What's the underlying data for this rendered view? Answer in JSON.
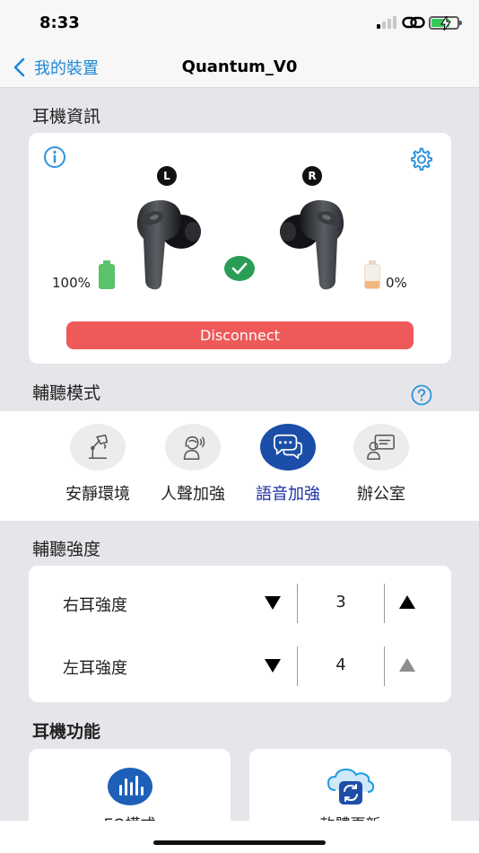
{
  "status_bar": {
    "time": "8:33"
  },
  "nav": {
    "back_label": "我的裝置",
    "title": "Quantum_V0"
  },
  "earbud_info": {
    "section_title": "耳機資訊",
    "left_badge": "L",
    "right_badge": "R",
    "left_battery": "100%",
    "right_battery": "0%",
    "left_battery_level": 1.0,
    "right_battery_level": 0.0,
    "connected": true,
    "disconnect_label": "Disconnect",
    "colors": {
      "disconnect": "#ee5a5a",
      "left_battery": "#59c26a",
      "right_battery": "#f5b57f",
      "check": "#2a9d55"
    }
  },
  "hearing_mode": {
    "section_title": "輔聽模式",
    "modes": [
      {
        "label": "安靜環境",
        "icon": "desk-lamp-icon",
        "active": false
      },
      {
        "label": "人聲加強",
        "icon": "voice-person-icon",
        "active": false
      },
      {
        "label": "語音加強",
        "icon": "speech-bubbles-icon",
        "active": true
      },
      {
        "label": "辦公室",
        "icon": "office-person-icon",
        "active": false
      }
    ],
    "colors": {
      "active": "#1a4ea8",
      "active_label": "#1c2fa3"
    }
  },
  "hearing_strength": {
    "section_title": "輔聽強度",
    "rows": [
      {
        "label": "右耳強度",
        "value": "3"
      },
      {
        "label": "左耳強度",
        "value": "4"
      }
    ]
  },
  "earbud_functions": {
    "section_title": "耳機功能",
    "items": [
      {
        "label": "EQ模式",
        "icon": "equalizer-icon"
      },
      {
        "label": "軟體更新",
        "icon": "cloud-sync-icon"
      }
    ]
  }
}
